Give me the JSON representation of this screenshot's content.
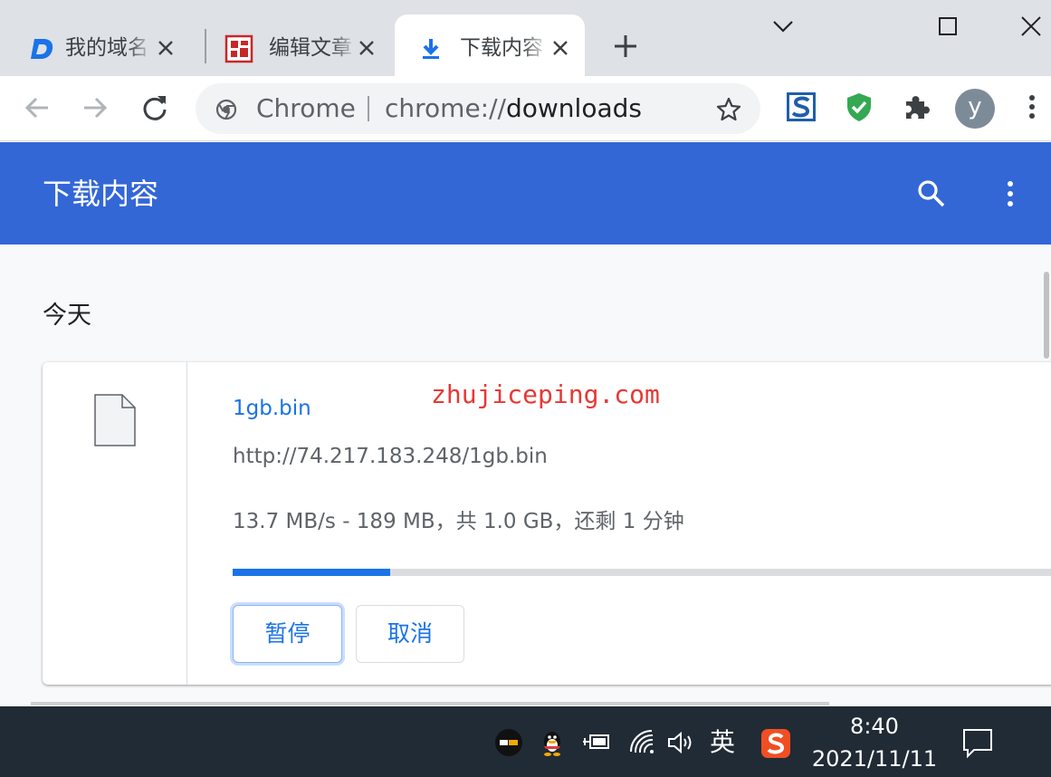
{
  "tabs": [
    {
      "label": "我的域名",
      "icon": "dnspod-d-icon",
      "active": false
    },
    {
      "label": "编辑文章",
      "icon": "seal-stamp-icon",
      "active": false
    },
    {
      "label": "下载内容",
      "icon": "download-arrow-icon",
      "active": true
    }
  ],
  "omnibox": {
    "scheme_label": "Chrome",
    "url_prefix": "chrome://",
    "url_path": "downloads"
  },
  "avatar_letter": "y",
  "downloads": {
    "title": "下载内容",
    "date_group": "今天",
    "items": [
      {
        "filename": "1gb.bin",
        "url": "http://74.217.183.248/1gb.bin",
        "status": "13.7 MB/s - 189 MB，共 1.0 GB，还剩 1 分钟",
        "progress_percent": 18.9,
        "pause_label": "暂停",
        "cancel_label": "取消"
      }
    ]
  },
  "watermark": "zhujiceping.com",
  "taskbar": {
    "ime_language": "英",
    "time": "8:40",
    "date": "2021/11/11"
  },
  "colors": {
    "header_blue": "#3367d6",
    "link_blue": "#1a73e8",
    "watermark_red": "#e53935",
    "taskbar_bg": "#202b36"
  }
}
